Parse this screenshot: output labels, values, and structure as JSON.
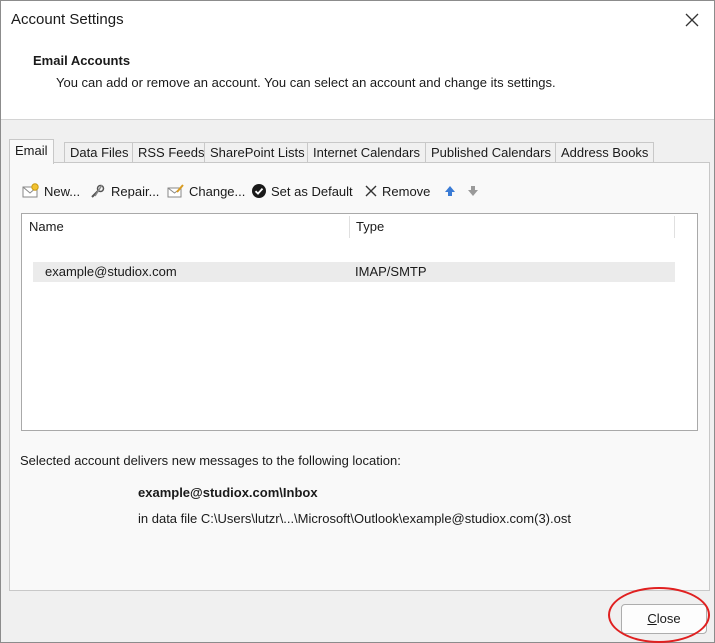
{
  "window": {
    "title": "Account Settings"
  },
  "header": {
    "title": "Email Accounts",
    "description": "You can add or remove an account. You can select an account and change its settings."
  },
  "tabs": [
    {
      "label": "Email",
      "active": true
    },
    {
      "label": "Data Files"
    },
    {
      "label": "RSS Feeds"
    },
    {
      "label": "SharePoint Lists"
    },
    {
      "label": "Internet Calendars"
    },
    {
      "label": "Published Calendars"
    },
    {
      "label": "Address Books"
    }
  ],
  "toolbar": {
    "new_label": "New...",
    "repair_label": "Repair...",
    "change_label": "Change...",
    "default_label": "Set as Default",
    "remove_label": "Remove",
    "move_up_icon": "arrow-up-icon",
    "move_down_icon": "arrow-down-icon"
  },
  "accounts_table": {
    "columns": [
      "Name",
      "Type"
    ],
    "rows": [
      {
        "name": "example@studiox.com",
        "type": "IMAP/SMTP",
        "selected": true
      }
    ]
  },
  "delivery": {
    "text": "Selected account delivers new messages to the following location:",
    "location": "example@studiox.com\\Inbox",
    "data_file": "in data file C:\\Users\\lutzr\\...\\Microsoft\\Outlook\\example@studiox.com(3).ost"
  },
  "footer": {
    "close_label_first": "C",
    "close_label_rest": "lose"
  },
  "colors": {
    "annotation": "#e02020",
    "selection": "#ebebeb",
    "arrow_up": "#3a7bd5",
    "arrow_down": "#9a9a9a"
  }
}
